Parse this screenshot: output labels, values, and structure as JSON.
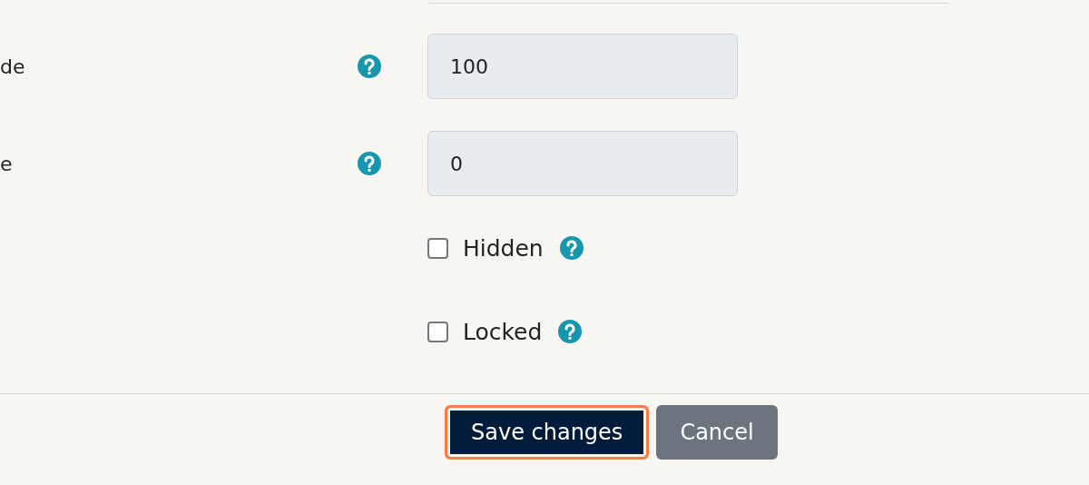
{
  "fields": [
    {
      "label": "de",
      "value": "100"
    },
    {
      "label": "e",
      "value": "0"
    }
  ],
  "checkboxes": [
    {
      "label": "Hidden",
      "checked": false
    },
    {
      "label": "Locked",
      "checked": false
    }
  ],
  "buttons": [
    {
      "label": "Save changes",
      "kind": "primary",
      "focused": true
    },
    {
      "label": "Cancel",
      "kind": "secondary",
      "focused": false
    }
  ]
}
